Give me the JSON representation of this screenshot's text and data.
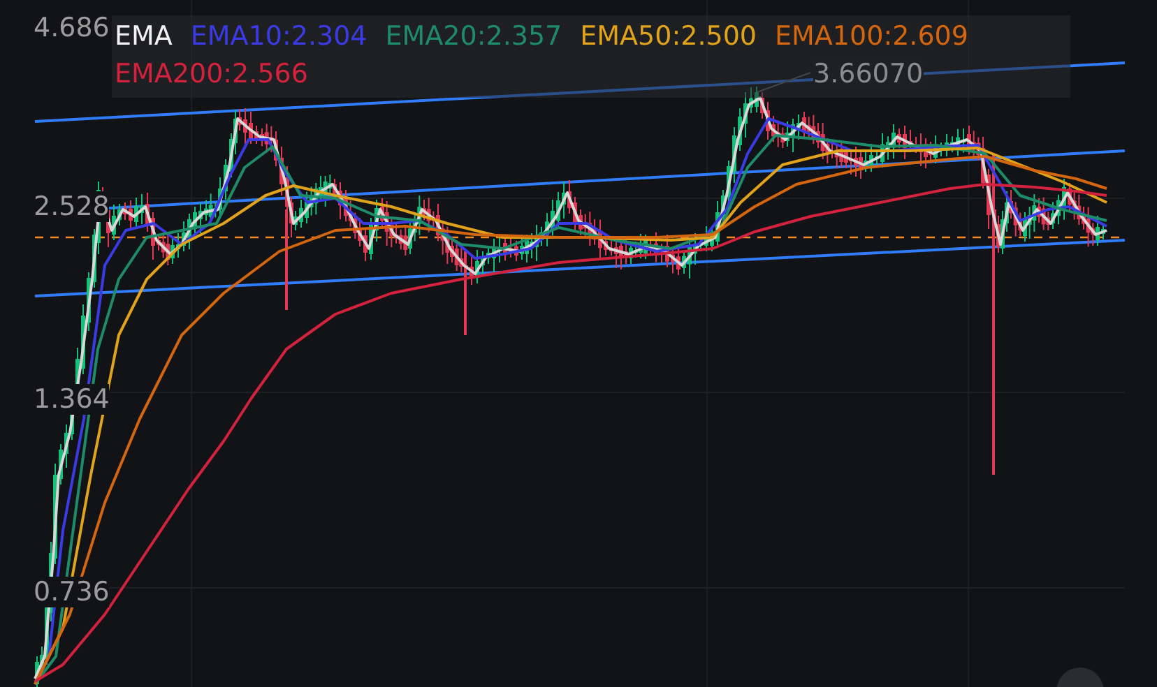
{
  "chart": {
    "y_axis_labels": [
      "4.686",
      "2.528",
      "1.364",
      "0.736"
    ],
    "indicator": "EMA",
    "legend": [
      {
        "label": "EMA10:2.304",
        "color": "#3b3be6"
      },
      {
        "label": "EMA20:2.357",
        "color": "#1e8c68"
      },
      {
        "label": "EMA50:2.500",
        "color": "#e1a31b"
      },
      {
        "label": "EMA100:2.609",
        "color": "#d4660f"
      },
      {
        "label": "EMA200:2.566",
        "color": "#d2223d"
      }
    ],
    "price_label": "3.66070"
  }
}
